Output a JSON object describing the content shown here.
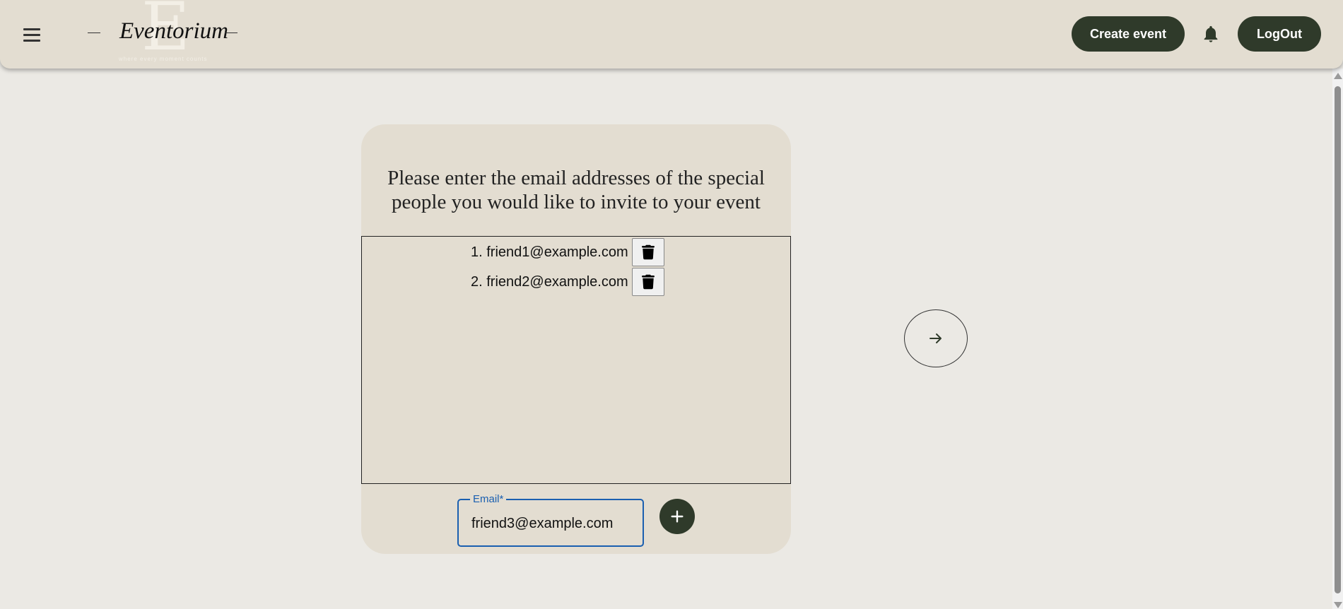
{
  "header": {
    "brand": "Eventorium",
    "brand_initial": "E",
    "tagline": "where every moment counts",
    "create_event_label": "Create event",
    "logout_label": "LogOut"
  },
  "invite": {
    "title": "Please enter the email addresses of the special people you would like to invite to your event",
    "emails": [
      {
        "label": "1. friend1@example.com"
      },
      {
        "label": "2. friend2@example.com"
      }
    ],
    "email_field": {
      "label": "Email*",
      "value": "friend3@example.com"
    }
  },
  "icons": {
    "menu": "hamburger-menu-icon",
    "bell": "bell-icon",
    "trash": "trash-icon",
    "add": "plus-icon",
    "next": "arrow-right-icon"
  },
  "colors": {
    "background": "#ebe9e4",
    "surface": "#e3ddd1",
    "primary": "#2f3a2a",
    "focus": "#1a5fb0"
  }
}
